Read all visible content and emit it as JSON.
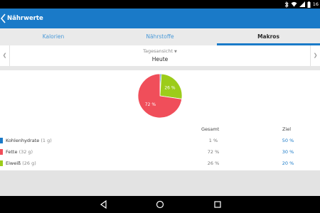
{
  "status_bar": {
    "time": "16",
    "icons": [
      "bluetooth-icon",
      "wifi-icon",
      "cellular-icon",
      "battery-icon"
    ]
  },
  "app_bar": {
    "title": "Nährwerte",
    "back_icon": "chevron-left-icon"
  },
  "tabs": [
    {
      "label": "Kalorien",
      "active": false
    },
    {
      "label": "Nährstoffe",
      "active": false
    },
    {
      "label": "Makros",
      "active": true
    }
  ],
  "date_selector": {
    "view_mode": "Tagesansicht",
    "date": "Heute"
  },
  "table": {
    "col_total": "Gesamt",
    "col_goal": "Ziel",
    "rows": [
      {
        "label": "Kohlenhydrate",
        "quantity": "(1 g)",
        "total": "1 %",
        "goal": "50 %",
        "color": "#1a7ac8"
      },
      {
        "label": "Fette",
        "quantity": "(32 g)",
        "total": "72 %",
        "goal": "30 %",
        "color": "#f04e5a"
      },
      {
        "label": "Eiweiß",
        "quantity": "(26 g)",
        "total": "26 %",
        "goal": "20 %",
        "color": "#9ccc1a"
      }
    ]
  },
  "chart_data": {
    "type": "pie",
    "slices": [
      {
        "label": "Kohlenhydrate",
        "value": 1,
        "color": "#1a7ac8",
        "display": ""
      },
      {
        "label": "Fette",
        "value": 72,
        "color": "#f04e5a",
        "display": "72 %"
      },
      {
        "label": "Eiweiß",
        "value": 26,
        "color": "#9ccc1a",
        "display": "26 %"
      }
    ]
  },
  "colors": {
    "primary": "#1a7ac8",
    "fat": "#f04e5a",
    "protein": "#9ccc1a"
  }
}
